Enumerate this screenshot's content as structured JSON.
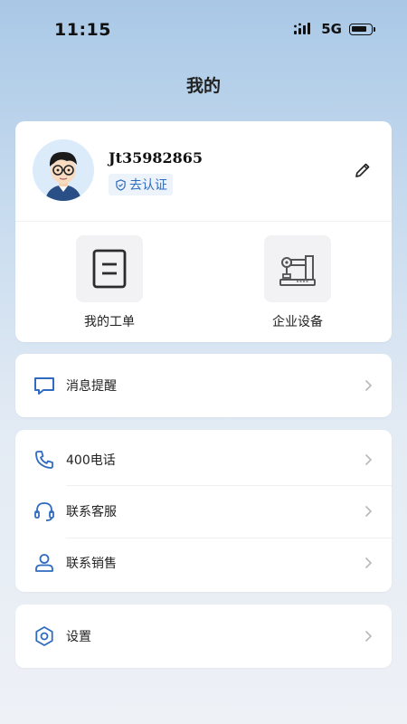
{
  "status_bar": {
    "time": "11:15",
    "network": "5G"
  },
  "header": {
    "title": "我的"
  },
  "profile": {
    "username": "Jt35982865",
    "verify_label": "去认证"
  },
  "quick_actions": [
    {
      "label": "我的工单",
      "icon": "document-icon"
    },
    {
      "label": "企业设备",
      "icon": "equipment-icon"
    }
  ],
  "menu_groups": [
    {
      "items": [
        {
          "label": "消息提醒",
          "icon": "message-icon"
        }
      ]
    },
    {
      "items": [
        {
          "label": "400电话",
          "icon": "phone-icon"
        },
        {
          "label": "联系客服",
          "icon": "headset-icon"
        },
        {
          "label": "联系销售",
          "icon": "person-icon"
        }
      ]
    },
    {
      "items": [
        {
          "label": "设置",
          "icon": "settings-icon"
        }
      ]
    }
  ],
  "colors": {
    "accent": "#2f6cc1",
    "icon_gray": "#333333",
    "chevron": "#b8b8b8"
  }
}
